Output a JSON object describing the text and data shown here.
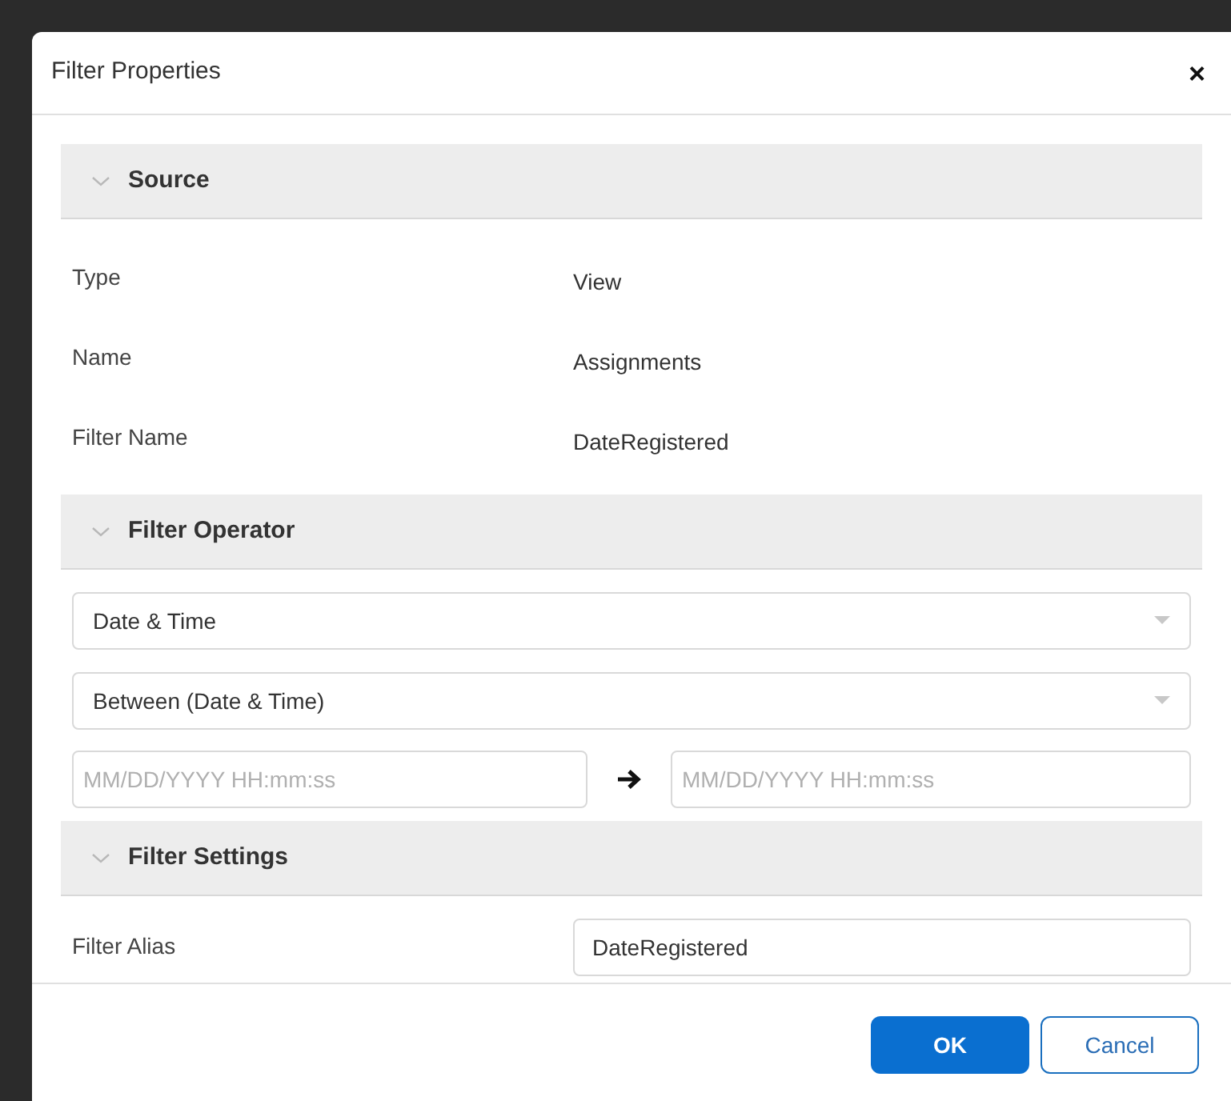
{
  "dialog": {
    "title": "Filter Properties",
    "close": "×"
  },
  "sections": [
    {
      "kind": "properties",
      "title": "Source",
      "expanded": true,
      "rows": [
        {
          "label": "Type",
          "value": "View"
        },
        {
          "label": "Name",
          "value": "Assignments"
        },
        {
          "label": "Filter Name",
          "value": "DateRegistered"
        }
      ]
    },
    {
      "kind": "operator",
      "title": "Filter Operator",
      "expanded": true,
      "selects": [
        {
          "value": "Date & Time"
        },
        {
          "value": "Between (Date & Time)"
        }
      ],
      "range": {
        "from": {
          "placeholder": "MM/DD/YYYY HH:mm:ss"
        },
        "to": {
          "placeholder": "MM/DD/YYYY HH:mm:ss"
        }
      }
    },
    {
      "kind": "settings",
      "title": "Filter Settings",
      "expanded": true,
      "fields": [
        {
          "label": "Filter Alias",
          "value": "DateRegistered"
        }
      ]
    }
  ],
  "buttons": [
    {
      "kind": "primary",
      "label": "OK"
    },
    {
      "kind": "secondary",
      "label": "Cancel"
    }
  ]
}
